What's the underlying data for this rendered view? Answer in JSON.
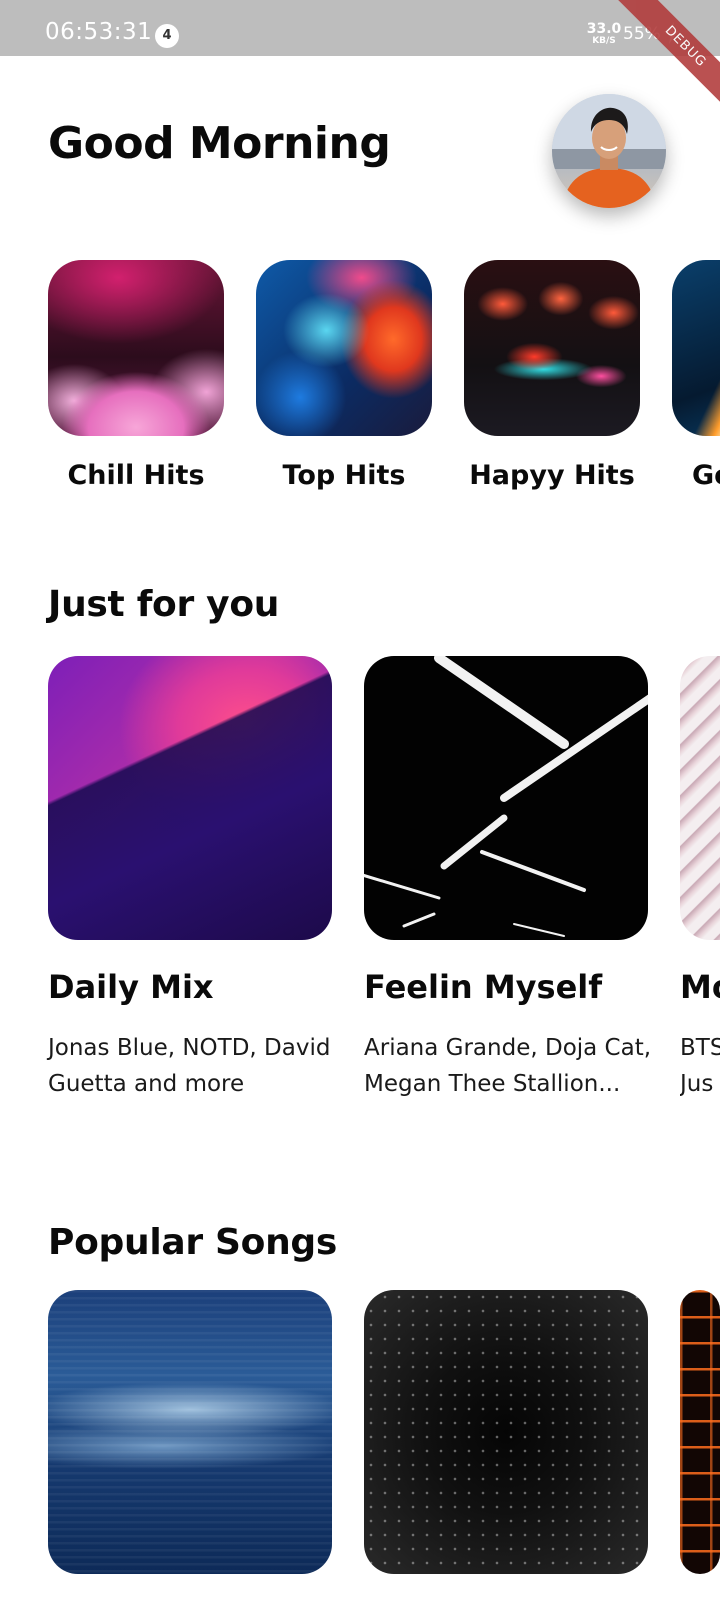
{
  "status_bar": {
    "time": "06:53:31",
    "notification_count": "4",
    "net_speed_value": "33.0",
    "net_speed_unit": "KB/S",
    "battery": "55%",
    "charging_icon": "bolt-icon"
  },
  "debug_banner": "DEBUG",
  "header": {
    "title": "Good Morning",
    "avatar_icon": "profile-avatar"
  },
  "playlists": [
    {
      "label": "Chill Hits"
    },
    {
      "label": "Top Hits"
    },
    {
      "label": "Hapyy Hits"
    },
    {
      "label": "Go"
    }
  ],
  "just_for_you": {
    "title": "Just for you",
    "items": [
      {
        "title": "Daily Mix",
        "description": "Jonas Blue, NOTD, David Guetta and more"
      },
      {
        "title": "Feelin Myself",
        "description": "Ariana Grande, Doja Cat, Megan Thee Stallion..."
      },
      {
        "title": "Mo",
        "description": "BTS Jus"
      }
    ]
  },
  "popular_songs": {
    "title": "Popular Songs"
  },
  "colors": {
    "status_bar": "#bdbdbd",
    "background": "#ffffff",
    "text": "#0a0a0a",
    "debug_ribbon": "#b13a3a"
  }
}
